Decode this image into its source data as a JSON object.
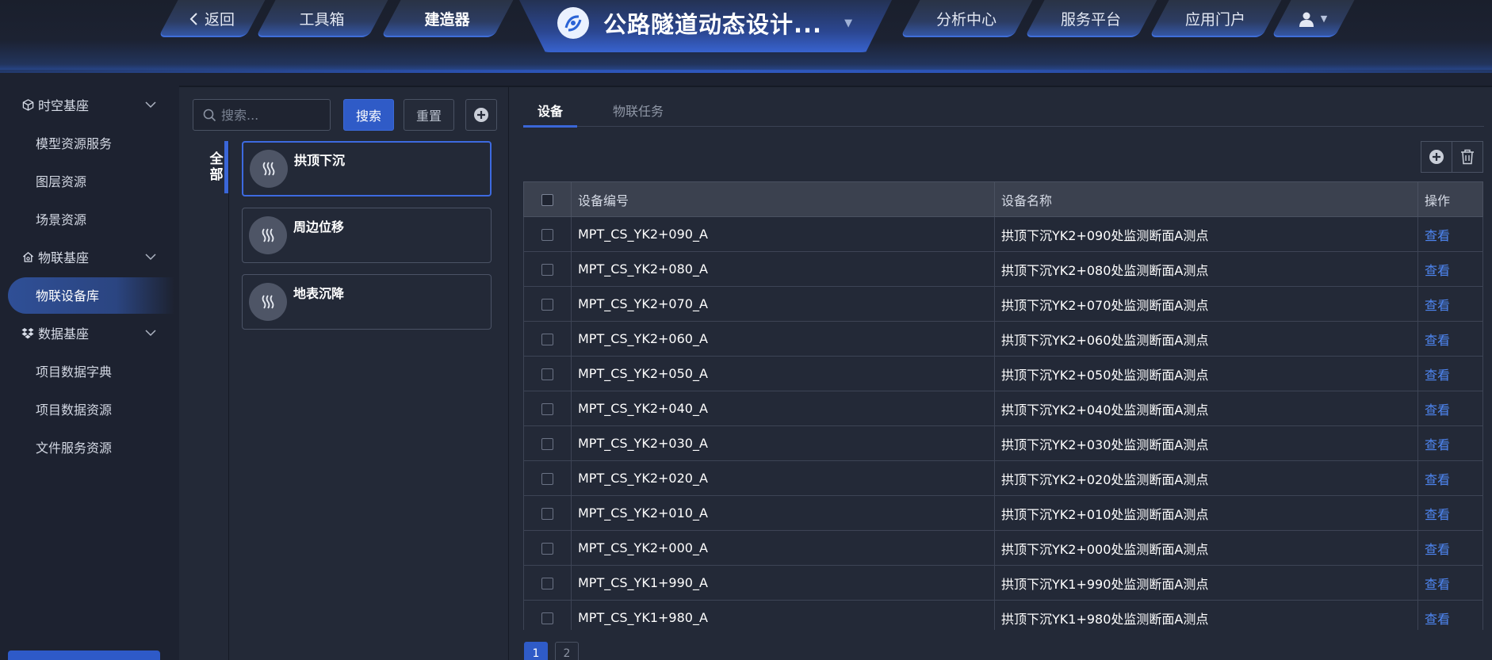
{
  "topnav": {
    "back": "返回",
    "toolbox": "工具箱",
    "builder": "建造器",
    "brand_title": "公路隧道动态设计...",
    "analysis": "分析中心",
    "service": "服务平台",
    "portal": "应用门户"
  },
  "sidebar": {
    "groups": [
      {
        "label": "时空基座",
        "icon": "cube-icon",
        "items": [
          "模型资源服务",
          "图层资源",
          "场景资源"
        ]
      },
      {
        "label": "物联基座",
        "icon": "home-icon",
        "items": [
          "物联设备库"
        ]
      },
      {
        "label": "数据基座",
        "icon": "dropbox-icon",
        "items": [
          "项目数据字典",
          "项目数据资源",
          "文件服务资源"
        ]
      }
    ],
    "active_item": "物联设备库"
  },
  "filter": {
    "search_placeholder": "搜索...",
    "search_button": "搜索",
    "reset_button": "重置",
    "all_tab_line1": "全",
    "all_tab_line2": "部"
  },
  "categories": [
    {
      "label": "拱顶下沉",
      "active": true
    },
    {
      "label": "周边位移",
      "active": false
    },
    {
      "label": "地表沉降",
      "active": false
    }
  ],
  "tabs": [
    {
      "label": "设备",
      "active": true
    },
    {
      "label": "物联任务",
      "active": false
    }
  ],
  "table": {
    "headers": {
      "code": "设备编号",
      "name": "设备名称",
      "action": "操作"
    },
    "action_label": "查看",
    "rows": [
      {
        "code": "MPT_CS_YK2+090_A",
        "name": "拱顶下沉YK2+090处监测断面A测点"
      },
      {
        "code": "MPT_CS_YK2+080_A",
        "name": "拱顶下沉YK2+080处监测断面A测点"
      },
      {
        "code": "MPT_CS_YK2+070_A",
        "name": "拱顶下沉YK2+070处监测断面A测点"
      },
      {
        "code": "MPT_CS_YK2+060_A",
        "name": "拱顶下沉YK2+060处监测断面A测点"
      },
      {
        "code": "MPT_CS_YK2+050_A",
        "name": "拱顶下沉YK2+050处监测断面A测点"
      },
      {
        "code": "MPT_CS_YK2+040_A",
        "name": "拱顶下沉YK2+040处监测断面A测点"
      },
      {
        "code": "MPT_CS_YK2+030_A",
        "name": "拱顶下沉YK2+030处监测断面A测点"
      },
      {
        "code": "MPT_CS_YK2+020_A",
        "name": "拱顶下沉YK2+020处监测断面A测点"
      },
      {
        "code": "MPT_CS_YK2+010_A",
        "name": "拱顶下沉YK2+010处监测断面A测点"
      },
      {
        "code": "MPT_CS_YK2+000_A",
        "name": "拱顶下沉YK2+000处监测断面A测点"
      },
      {
        "code": "MPT_CS_YK1+990_A",
        "name": "拱顶下沉YK1+990处监测断面A测点"
      },
      {
        "code": "MPT_CS_YK1+980_A",
        "name": "拱顶下沉YK1+980处监测断面A测点"
      }
    ]
  },
  "pagination": {
    "pages": [
      "1",
      "2"
    ],
    "current": "1"
  },
  "colors": {
    "accent": "#2f5bc7",
    "link": "#4e86f2",
    "background": "#1d2230",
    "panel": "#232937"
  }
}
